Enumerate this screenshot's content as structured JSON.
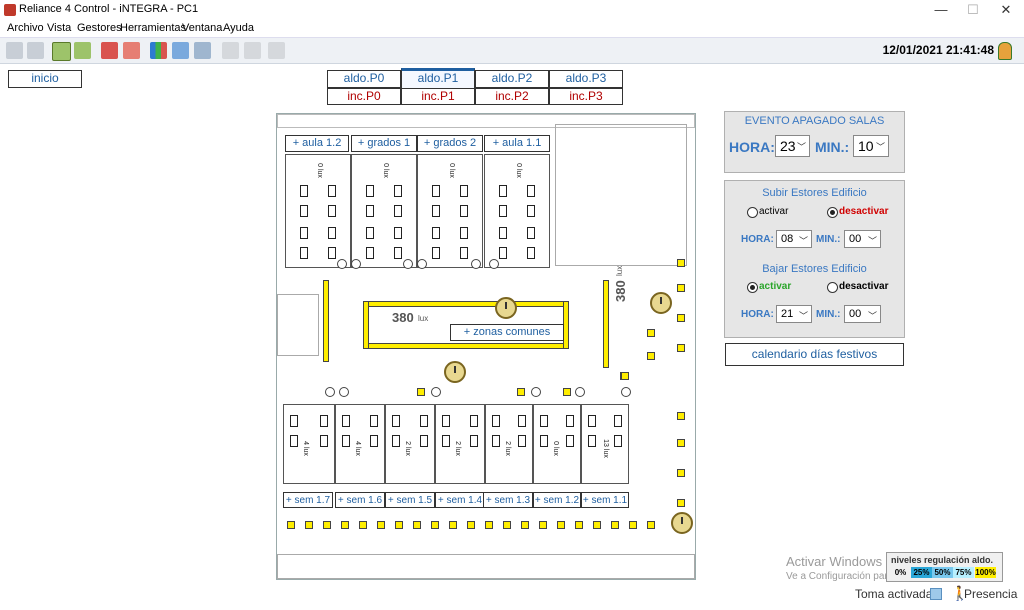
{
  "window": {
    "title": "Reliance 4 Control - iNTEGRA - PC1"
  },
  "menu": [
    "Archivo",
    "Vista",
    "Gestores",
    "Herramientas",
    "Ventana",
    "Ayuda"
  ],
  "toolbar": {
    "datetime": "12/01/2021 21:41:48"
  },
  "nav": {
    "inicio": "inicio"
  },
  "floor_tabs": {
    "aldo": [
      "aldo.P0",
      "aldo.P1",
      "aldo.P2",
      "aldo.P3"
    ],
    "inc": [
      "inc.P0",
      "inc.P1",
      "inc.P2",
      "inc.P3"
    ]
  },
  "plan": {
    "top_rooms": [
      "+ aula 1.2",
      "+ grados 1",
      "+ grados 2",
      "+ aula 1.1"
    ],
    "top_lux": [
      "0 lux",
      "0 lux",
      "0 lux",
      "0 lux"
    ],
    "center_value": "380",
    "center_unit": "lux",
    "center_button": "+ zonas comunes",
    "right_value": "380",
    "right_unit": "lux",
    "bottom_rooms": [
      "+ sem 1.7",
      "+ sem 1.6",
      "+ sem 1.5",
      "+ sem 1.4",
      "+ sem 1.3",
      "+ sem 1.2",
      "+ sem 1.1"
    ],
    "bottom_lux": [
      "4 lux",
      "4 lux",
      "2 lux",
      "2 lux",
      "2 lux",
      "0 lux",
      "13 lux"
    ]
  },
  "evento": {
    "title": "EVENTO APAGADO SALAS",
    "hora_label": "HORA:",
    "hora": "23",
    "min_label": "MIN.:",
    "min": "10"
  },
  "subir": {
    "title": "Subir Estores Edificio",
    "activar": "activar",
    "desactivar": "desactivar",
    "hora_label": "HORA:",
    "hora": "08",
    "min_label": "MIN.:",
    "min": "00"
  },
  "bajar": {
    "title": "Bajar Estores Edificio",
    "activar": "activar",
    "desactivar": "desactivar",
    "hora_label": "HORA:",
    "hora": "21",
    "min_label": "MIN.:",
    "min": "00"
  },
  "calendario": "calendario días festivos",
  "legend": {
    "title": "niveles regulación aldo.",
    "levels": [
      "0%",
      "25%",
      "50%",
      "75%",
      "100%"
    ],
    "colors": [
      "#ffffff",
      "#2aa7d8",
      "#79c8ee",
      "#b8f0ff",
      "#ffee00"
    ]
  },
  "watermark": {
    "line1": "Activar Windows",
    "line2": "Ve a Configuración para activar Windows."
  },
  "status": {
    "toma": "Toma activada",
    "presencia": "Presencia"
  }
}
